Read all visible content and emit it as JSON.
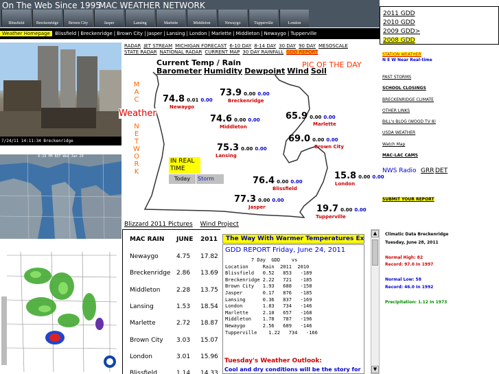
{
  "header": {
    "slogan": "On The Web Since 1995",
    "network": "MAC WEATHER NETWORK",
    "towns": [
      "Blissfield",
      "Breckenridge",
      "Brown City",
      "Jasper",
      "Lansing",
      "Marlette",
      "Middleton",
      "Newaygo",
      "Tupperville",
      "London"
    ]
  },
  "nav": {
    "home": "Weather Homepage",
    "items": [
      "Blissfield",
      "Breckenridge",
      "Brown City",
      "Jasper",
      "Lansing",
      "London",
      "Marlette",
      "Middleton",
      "Newaygo",
      "Tupperville"
    ]
  },
  "left": {
    "cam_caption": "7/24/11 14:11:34 Breckenridge",
    "sat_caption": "6:19 PM EDT Wed Jan 29"
  },
  "map_links": {
    "row1": [
      "RADAR",
      "JET STREAM",
      "MICHIGAN FORECAST",
      "6-10 DAY",
      "8-14 DAY",
      "30 DAY",
      "90 DAY",
      "MESOSCALE"
    ],
    "row2": [
      "STATE RADAR",
      "NATIONAL RADAR",
      "CURRENT MAP",
      "30 DAY RAINFALL"
    ],
    "gdd": "GDD REPORT"
  },
  "map": {
    "heading": "Current Temp / Rain",
    "tabs": [
      "Barometer",
      "Humidity",
      "Dewpoint",
      "Wind",
      "Soil"
    ],
    "pic_of_day": "PIC OF THE DAY",
    "mac_vertical": "MAC",
    "weather": "Weather",
    "network_vertical": "NETWORK",
    "realtime": "IN REAL TIME",
    "today": "Today",
    "storm": "Storm",
    "stations": [
      {
        "name": "Newaygo",
        "temp": "74.8",
        "rain": "0.01",
        "gdd": "0.00"
      },
      {
        "name": "Breckenridge",
        "temp": "73.9",
        "rain": "0.00",
        "gdd": "0.00"
      },
      {
        "name": "Middleton",
        "temp": "74.6",
        "rain": "0.00",
        "gdd": "0.00"
      },
      {
        "name": "Marlette",
        "temp": "65.9",
        "rain": "0.00",
        "gdd": "0.00"
      },
      {
        "name": "Brown City",
        "temp": "69.0",
        "rain": "0.00",
        "gdd": "0.00"
      },
      {
        "name": "Lansing",
        "temp": "75.3",
        "rain": "0.00",
        "gdd": "0.00"
      },
      {
        "name": "Blissfield",
        "temp": "76.4",
        "rain": "0.00",
        "gdd": "0.00"
      },
      {
        "name": "London",
        "temp": "15.8",
        "rain": "0.00",
        "gdd": "0.00"
      },
      {
        "name": "Jasper",
        "temp": "77.3",
        "rain": "0.00",
        "gdd": "0.00"
      },
      {
        "name": "Tupperville",
        "temp": "19.7",
        "rain": "0.00",
        "gdd": "0.00"
      }
    ]
  },
  "gdd_years": [
    "2011 GDD",
    "2010 GDD",
    "2009 GDD>",
    "2008 GDD"
  ],
  "right_links": {
    "station_weather": "STATION WEATHER",
    "near_realtime": "N E W Near Real-time",
    "past_storms": "PAST STORMS",
    "school_closings": "SCHOOL CLOSINGS",
    "breck_climate": "BRECKENRIDGE CLIMATE",
    "other_links": "OTHER LINKS",
    "bills_blog": "BILL's BLOG (WOOD TV 8)",
    "usda": "USDA WEATHER",
    "watch_map": "Watch Map",
    "mac_lac": "MAC-LAC CAMS",
    "nws_radio": "NWS Radio",
    "grr": "GRR",
    "det": "DET",
    "submit": "SUBMIT YOUR REPORT"
  },
  "climate": {
    "title": "Climatic Data Breckenridge",
    "date": "Tuesday, June 28, 2011",
    "normal_high": "Normal High: 82",
    "record_high": "Record: 97.0  In  1997",
    "normal_low": "Normal Low: 58",
    "record_low": "Record: 46.0  In  1992",
    "precip": "Precipitation: 1.12 In 1973"
  },
  "tab_links": [
    "Blizzard 2011 Pictures",
    "Wind Project"
  ],
  "rain_table": {
    "headers": [
      "MAC RAIN",
      "JUNE",
      "2011"
    ],
    "rows": [
      [
        "Newaygo",
        "4.75",
        "17.82"
      ],
      [
        "Breckenridge",
        "2.86",
        "13.69"
      ],
      [
        "Middleton",
        "2.28",
        "13.75"
      ],
      [
        "Lansing",
        "1.53",
        "18.54"
      ],
      [
        "Marlette",
        "2.72",
        "18.87"
      ],
      [
        "Brown City",
        "3.03",
        "15.07"
      ],
      [
        "London",
        "3.01",
        "15.96"
      ],
      [
        "Blissfield",
        "1.14",
        "14.33"
      ]
    ]
  },
  "ticker": "The Way With Warmer Temperatures Exp",
  "gdd_report": {
    "title": "GDD REPORT Friday, June 24, 2011",
    "table": "         7 Day  GDD    vs\nLocation     Rain  2011  2010\nBlissfield   0.52   853   -189\nBreckenridge 2.22   721   -185\nBrown City   1.93   688   -158\nJasper       0.17   876   -185\nLansing      0.36   837   -169\nLondon       1.83   734   -146\nMarlette     2.10   657   -168\nMiddleton    1.78   787   -196\nNewaygo      2.56   689   -146\nTupperville    1.22   734   -166",
    "outlook_title": "Tuesday's Weather Outlook:",
    "outlook_text": "Cool and dry conditions will be the story for"
  }
}
